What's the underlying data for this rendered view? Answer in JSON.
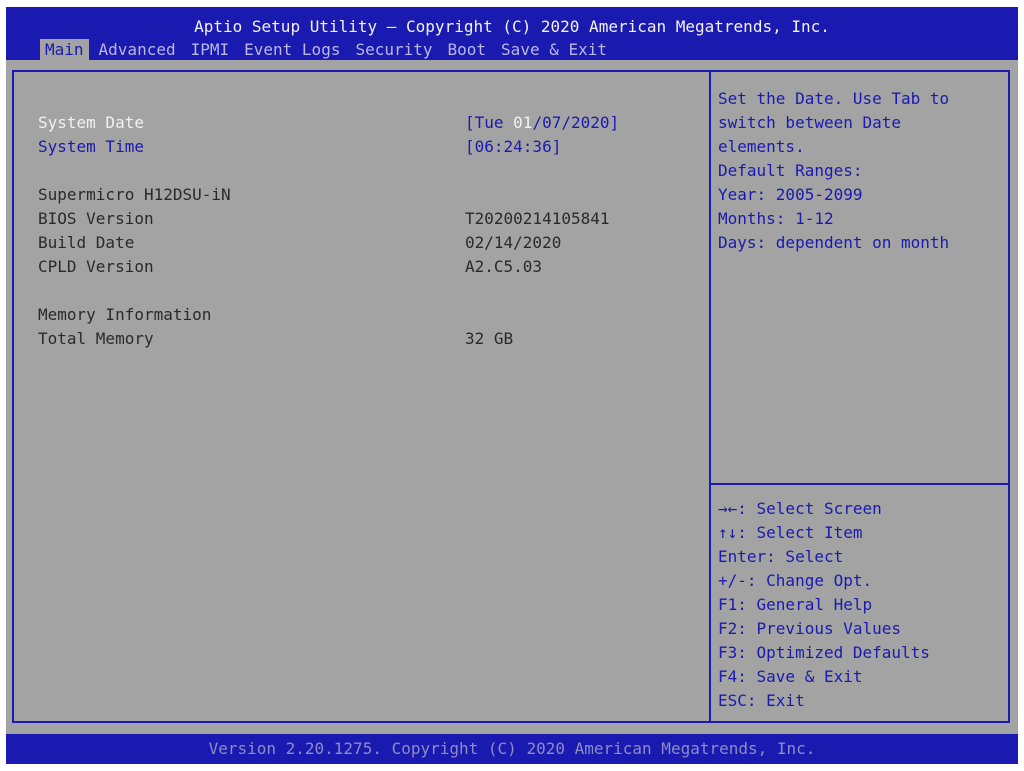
{
  "header": {
    "title": "Aptio Setup Utility – Copyright (C) 2020 American Megatrends, Inc."
  },
  "tabs": [
    {
      "label": "Main",
      "active": true
    },
    {
      "label": "Advanced"
    },
    {
      "label": "IPMI"
    },
    {
      "label": "Event Logs"
    },
    {
      "label": "Security"
    },
    {
      "label": "Boot"
    },
    {
      "label": "Save & Exit"
    }
  ],
  "main": {
    "system_date": {
      "label": "System Date",
      "value_prefix": "[Tue ",
      "value_selected": "01",
      "value_suffix": "/07/2020]"
    },
    "system_time": {
      "label": "System Time",
      "value": "[06:24:36]"
    },
    "board_name": "Supermicro H12DSU-iN",
    "bios_version": {
      "label": "BIOS Version",
      "value": "T20200214105841"
    },
    "build_date": {
      "label": "Build Date",
      "value": "02/14/2020"
    },
    "cpld_version": {
      "label": "CPLD Version",
      "value": "A2.C5.03"
    },
    "memory_heading": "Memory Information",
    "total_memory": {
      "label": "Total Memory",
      "value": "32 GB"
    }
  },
  "help": {
    "description": [
      "Set the Date. Use Tab to",
      "switch between Date",
      "elements.",
      "Default Ranges:",
      "Year: 2005-2099",
      "Months: 1-12",
      "Days: dependent on month"
    ],
    "keys": [
      "→←: Select Screen",
      "↑↓: Select Item",
      "Enter: Select",
      "+/-: Change Opt.",
      "F1: General Help",
      "F2: Previous Values",
      "F3: Optimized Defaults",
      "F4: Save & Exit",
      "ESC: Exit"
    ]
  },
  "footer": {
    "text": "Version 2.20.1275. Copyright (C) 2020 American Megatrends, Inc."
  },
  "colors": {
    "background": "#a3a3a3",
    "accent_blue": "#1a1ab0",
    "highlight": "#f2f2f2"
  }
}
